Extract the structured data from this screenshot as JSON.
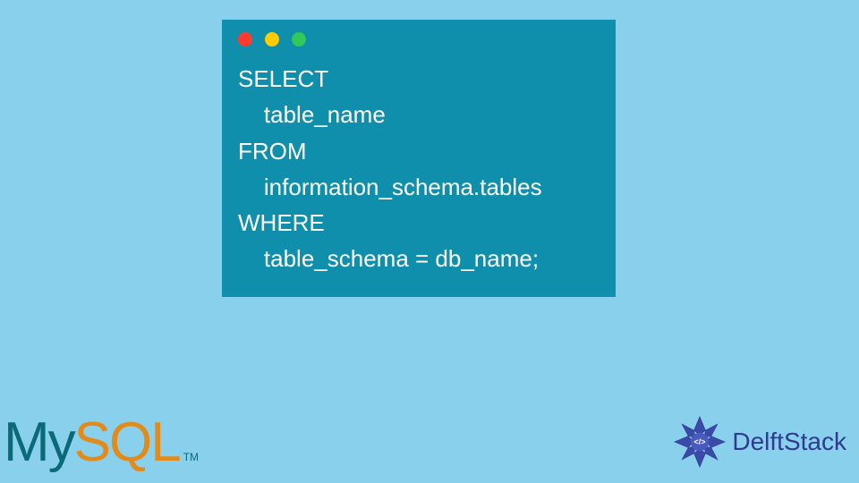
{
  "code_window": {
    "lines": "SELECT\n    table_name\nFROM\n    information_schema.tables\nWHERE\n    table_schema = db_name;"
  },
  "logos": {
    "mysql": {
      "part1": "My",
      "part2": "SQL",
      "tm": "TM"
    },
    "delft": {
      "text": "DelftStack"
    }
  },
  "colors": {
    "background": "#89d0ed",
    "window": "#0f8fab",
    "code_text": "#ffffff",
    "mysql_my": "#0a6a78",
    "mysql_sql": "#e38b1a",
    "delft": "#2f3b8f"
  }
}
